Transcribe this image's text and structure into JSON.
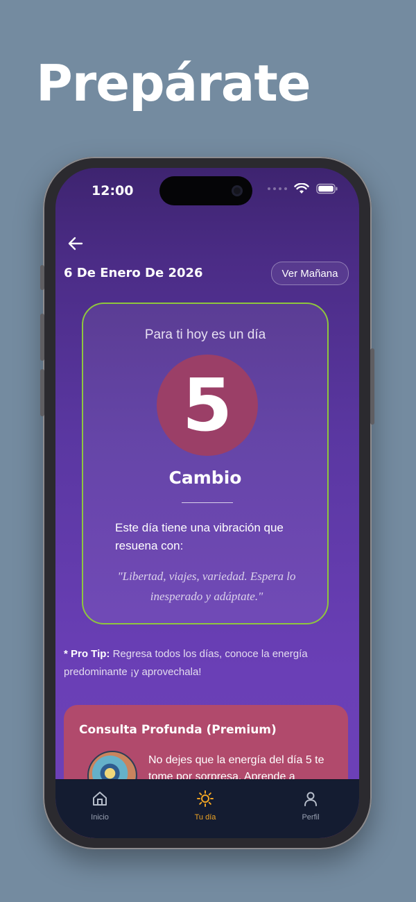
{
  "headline": "Prepárate",
  "status_bar": {
    "time": "12:00"
  },
  "header": {
    "date": "6 De Enero De 2026",
    "next_button": "Ver Mañana"
  },
  "day_card": {
    "subtitle": "Para ti hoy es un día",
    "number": "5",
    "title": "Cambio",
    "description": "Este día tiene una vibración que resuena con:",
    "quote": "\"Libertad, viajes, variedad. Espera lo inesperado y adáptate.\""
  },
  "pro_tip": {
    "label": "* Pro Tip:",
    "text": "Regresa todos los días, conoce la energía predominante ¡y aprovechala!"
  },
  "premium": {
    "title": "Consulta Profunda (Premium)",
    "text": "No dejes que la energía del día 5 te tome por sorpresa. Aprende a"
  },
  "tabs": [
    {
      "label": "Inicio",
      "icon": "home-icon",
      "active": false
    },
    {
      "label": "Tu día",
      "icon": "sun-icon",
      "active": true
    },
    {
      "label": "Perfil",
      "icon": "user-icon",
      "active": false
    }
  ],
  "colors": {
    "background": "#748ba0",
    "card_border": "#8fc63d",
    "number_circle": "#9b3f67",
    "premium_card": "#b14a6c",
    "tab_active": "#f1a524"
  }
}
